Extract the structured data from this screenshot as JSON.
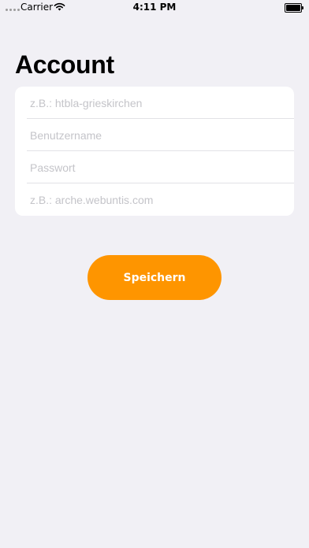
{
  "status_bar": {
    "carrier": "Carrier",
    "time": "4:11 PM",
    "icons": [
      "signal-dots-icon",
      "wifi-icon",
      "battery-icon"
    ]
  },
  "page": {
    "title": "Account"
  },
  "form": {
    "fields": [
      {
        "placeholder": "z.B.: htbla-grieskirchen",
        "value": ""
      },
      {
        "placeholder": "Benutzername",
        "value": ""
      },
      {
        "placeholder": "Passwort",
        "value": ""
      },
      {
        "placeholder": "z.B.: arche.webuntis.com",
        "value": ""
      }
    ]
  },
  "actions": {
    "save_label": "Speichern"
  },
  "colors": {
    "background": "#f1f0f5",
    "card": "#ffffff",
    "accent": "#fe9500",
    "placeholder": "#c4c4c9"
  }
}
